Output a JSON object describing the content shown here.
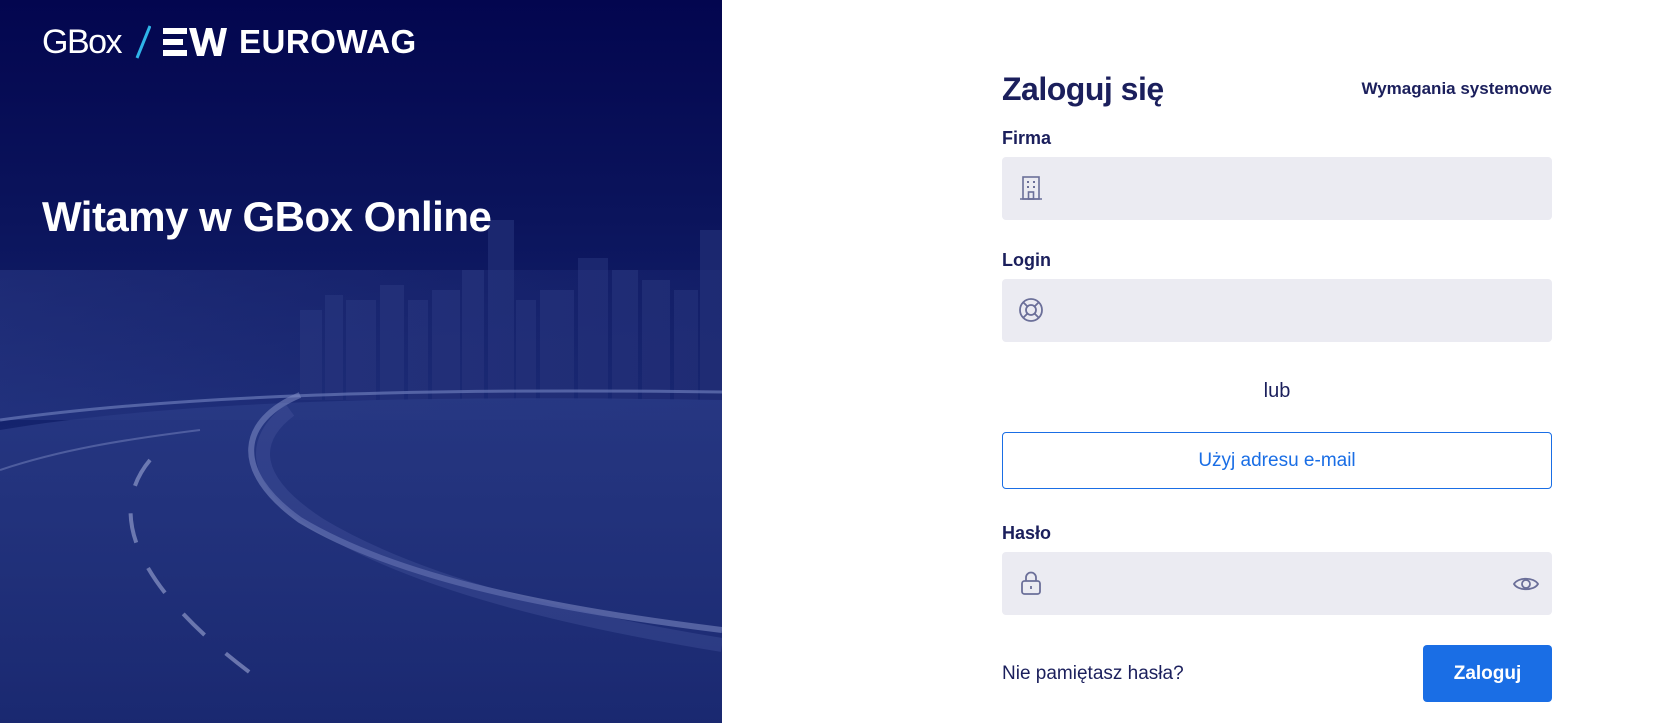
{
  "brand": {
    "gbox_text": "GBox",
    "partner_text": "EUROWAG",
    "ew_mark_icon": "ew-logo-mark",
    "accent_slash_color": "#2fb4e8"
  },
  "hero": {
    "welcome": "Witamy w GBox Online"
  },
  "form": {
    "title": "Zaloguj się",
    "system_requirements_link": "Wymagania systemowe",
    "company": {
      "label": "Firma",
      "value": "",
      "icon": "building-icon"
    },
    "login": {
      "label": "Login",
      "value": "",
      "icon": "lifebuoy-icon"
    },
    "or_text": "lub",
    "email_button": "Użyj adresu e-mail",
    "password": {
      "label": "Hasło",
      "value": "",
      "icon": "lock-icon",
      "toggle_icon": "eye-icon"
    },
    "forgot_link": "Nie pamiętasz hasła?",
    "submit": "Zaloguj"
  },
  "colors": {
    "primary": "#1a6ee5",
    "text_dark": "#1b1f5c",
    "input_bg": "#ebebf2",
    "hero_bg": "#03064f"
  }
}
